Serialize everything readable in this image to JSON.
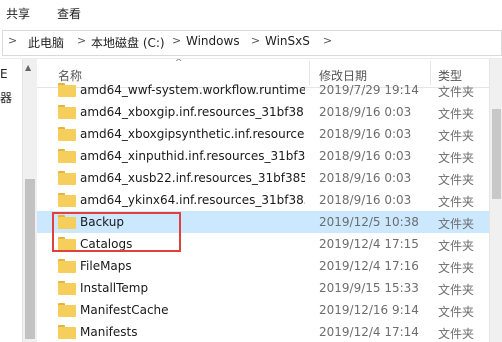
{
  "ribbon": {
    "tabs": [
      "共享",
      "查看"
    ]
  },
  "address": {
    "crumbs": [
      "此电脑",
      "本地磁盘 (C:)",
      "Windows",
      "WinSxS"
    ]
  },
  "nav": {
    "labels": [
      "E",
      "器"
    ]
  },
  "columns": {
    "name": "名称",
    "date": "修改日期",
    "type": "类型"
  },
  "rows": [
    {
      "name": "amd64_wwf-system.workflow.runtime...",
      "date": "2019/7/29 19:14",
      "type": "文件夹"
    },
    {
      "name": "amd64_xboxgip.inf.resources_31bf38...",
      "date": "2018/9/16 0:03",
      "type": "文件夹"
    },
    {
      "name": "amd64_xboxgipsynthetic.inf.resource...",
      "date": "2018/9/16 0:03",
      "type": "文件夹"
    },
    {
      "name": "amd64_xinputhid.inf.resources_31bf3...",
      "date": "2018/9/16 0:03",
      "type": "文件夹"
    },
    {
      "name": "amd64_xusb22.inf.resources_31bf385...",
      "date": "2018/9/16 0:03",
      "type": "文件夹"
    },
    {
      "name": "amd64_ykinx64.inf.resources_31bf385...",
      "date": "2018/9/16 0:03",
      "type": "文件夹"
    },
    {
      "name": "Backup",
      "date": "2019/12/5 10:38",
      "type": "文件夹"
    },
    {
      "name": "Catalogs",
      "date": "2019/12/4 17:15",
      "type": "文件夹"
    },
    {
      "name": "FileMaps",
      "date": "2019/12/4 17:16",
      "type": "文件夹"
    },
    {
      "name": "InstallTemp",
      "date": "2019/9/15 15:33",
      "type": "文件夹"
    },
    {
      "name": "ManifestCache",
      "date": "2019/12/16 9:14",
      "type": "文件夹"
    },
    {
      "name": "Manifests",
      "date": "2019/12/4 17:14",
      "type": "文件夹"
    }
  ],
  "selected_index": 6,
  "colors": {
    "selection": "#cce8ff",
    "highlight": "#e0403e",
    "folder": "#f6ce5b"
  }
}
